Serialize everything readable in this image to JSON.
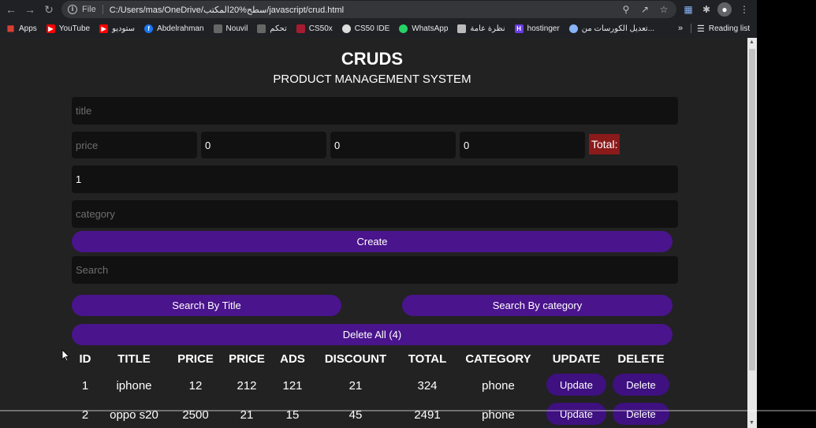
{
  "browser": {
    "file_label": "File",
    "url": "C:/Users/mas/OneDrive/سطح%20المكتب/javascript/crud.html",
    "bookmarks": [
      {
        "label": "Apps",
        "icon": "apps-grid-icon",
        "color": "#ea4335"
      },
      {
        "label": "YouTube",
        "icon": "youtube-icon",
        "color": "#ff0000"
      },
      {
        "label": "ستوديو",
        "icon": "youtube-studio-icon",
        "color": "#ff0000"
      },
      {
        "label": "Abdelrahman",
        "icon": "facebook-icon",
        "color": "#1877f2"
      },
      {
        "label": "Nouvil",
        "icon": "bookmark-favicon-icon",
        "color": "#888888"
      },
      {
        "label": "تحكم",
        "icon": "bookmark-favicon-icon",
        "color": "#888888"
      },
      {
        "label": "CS50x",
        "icon": "cs50-icon",
        "color": "#a51c30"
      },
      {
        "label": "CS50 IDE",
        "icon": "github-icon",
        "color": "#dddddd"
      },
      {
        "label": "WhatsApp",
        "icon": "whatsapp-icon",
        "color": "#25d366"
      },
      {
        "label": "نظرة عامة",
        "icon": "car-icon",
        "color": "#bbbbbb"
      },
      {
        "label": "hostinger",
        "icon": "hostinger-icon",
        "color": "#673de6"
      },
      {
        "label": "تعديل الكورسات من...",
        "icon": "globe-icon",
        "color": "#8ab4f8"
      }
    ],
    "bookmarks_more": "»",
    "reading_list": "Reading list"
  },
  "app": {
    "title": "CRUDS",
    "subtitle": "PRODUCT MANAGEMENT SYSTEM"
  },
  "form": {
    "title_placeholder": "title",
    "price_placeholder": "price",
    "taxes_value": "0",
    "ads_value": "0",
    "discount_value": "0",
    "total_label": "Total:",
    "count_value": "1",
    "category_placeholder": "category",
    "create_label": "Create",
    "search_placeholder": "Search",
    "search_title_label": "Search By Title",
    "search_category_label": "Search By category",
    "delete_all_label": "Delete All (4)"
  },
  "table": {
    "headers": [
      "ID",
      "TITLE",
      "PRICE",
      "PRICE",
      "ADS",
      "DISCOUNT",
      "TOTAL",
      "CATEGORY",
      "UPDATE",
      "DELETE"
    ],
    "rows": [
      {
        "id": "1",
        "title": "iphone",
        "price": "12",
        "taxes": "212",
        "ads": "121",
        "discount": "21",
        "total": "324",
        "category": "phone",
        "update": "Update",
        "delete": "Delete"
      },
      {
        "id": "2",
        "title": "oppo s20",
        "price": "2500",
        "taxes": "21",
        "ads": "15",
        "discount": "45",
        "total": "2491",
        "category": "phone",
        "update": "Update",
        "delete": "Delete"
      }
    ]
  }
}
